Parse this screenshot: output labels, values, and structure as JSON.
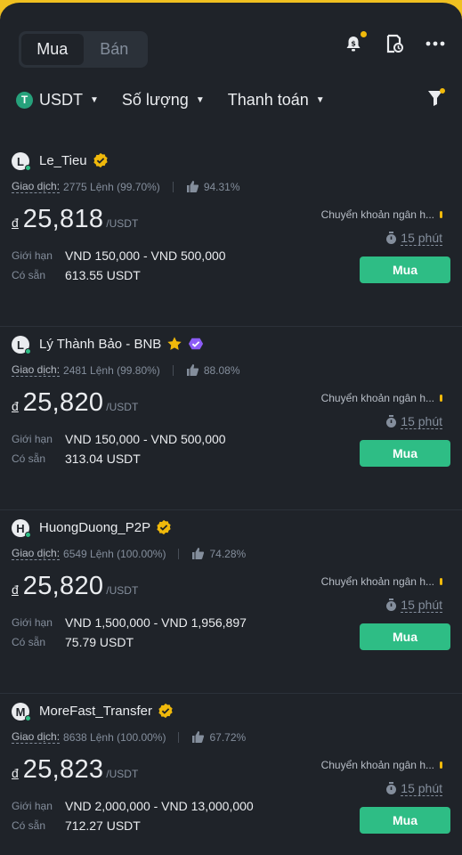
{
  "header": {
    "tabs": [
      {
        "label": "Mua",
        "active": true
      },
      {
        "label": "Bán",
        "active": false
      }
    ]
  },
  "filters": {
    "asset": "USDT",
    "asset_icon": "T",
    "amount": "Số lượng",
    "payment": "Thanh toán"
  },
  "colors": {
    "buy": "#2ebd85",
    "accent": "#f0b90b",
    "background": "#1f2329"
  },
  "ads": [
    {
      "avatar": "L",
      "name": "Le_Tieu",
      "badge": "gold-verified",
      "trades_label": "Giao dịch:",
      "trades": "2775 Lệnh",
      "completion": "(99.70%)",
      "rating": "94.31%",
      "currency": "đ",
      "price": "25,818",
      "unit": "/USDT",
      "limit_label": "Giới hạn",
      "limit": "VND 150,000 - VND 500,000",
      "available_label": "Có sẵn",
      "available": "613.55 USDT",
      "payment": "Chuyển khoản ngân h...",
      "time": "15 phút",
      "button": "Mua"
    },
    {
      "avatar": "L",
      "name": "Lý Thành Bảo - BNB",
      "badge": "star-purple",
      "trades_label": "Giao dịch:",
      "trades": "2481 Lệnh",
      "completion": "(99.80%)",
      "rating": "88.08%",
      "currency": "đ",
      "price": "25,820",
      "unit": "/USDT",
      "limit_label": "Giới hạn",
      "limit": "VND 150,000 - VND 500,000",
      "available_label": "Có sẵn",
      "available": "313.04 USDT",
      "payment": "Chuyển khoản ngân h...",
      "time": "15 phút",
      "button": "Mua"
    },
    {
      "avatar": "H",
      "name": "HuongDuong_P2P",
      "badge": "gold-verified",
      "trades_label": "Giao dịch:",
      "trades": "6549 Lệnh",
      "completion": "(100.00%)",
      "rating": "74.28%",
      "currency": "đ",
      "price": "25,820",
      "unit": "/USDT",
      "limit_label": "Giới hạn",
      "limit": "VND 1,500,000 - VND 1,956,897",
      "available_label": "Có sẵn",
      "available": "75.79 USDT",
      "payment": "Chuyển khoản ngân h...",
      "time": "15 phút",
      "button": "Mua"
    },
    {
      "avatar": "M",
      "name": "MoreFast_Transfer",
      "badge": "gold-verified",
      "trades_label": "Giao dịch:",
      "trades": "8638 Lệnh",
      "completion": "(100.00%)",
      "rating": "67.72%",
      "currency": "đ",
      "price": "25,823",
      "unit": "/USDT",
      "limit_label": "Giới hạn",
      "limit": "VND 2,000,000 - VND 13,000,000",
      "available_label": "Có sẵn",
      "available": "712.27 USDT",
      "payment": "Chuyển khoản ngân h...",
      "time": "15 phút",
      "button": "Mua"
    }
  ]
}
